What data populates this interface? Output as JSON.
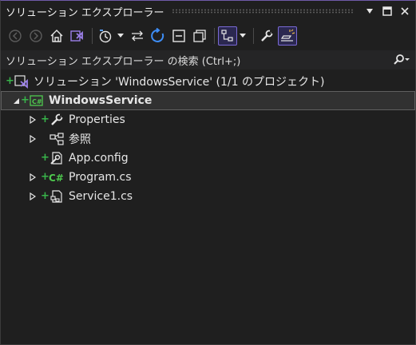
{
  "window": {
    "title": "ソリューション エクスプローラー"
  },
  "search": {
    "placeholder": "ソリューション エクスプローラー の検索 (Ctrl+;)"
  },
  "toolbar": {
    "buttons": [
      "back",
      "forward",
      "home",
      "switch-views",
      "pending-changes-filter",
      "sync-with-active-document",
      "refresh",
      "collapse-all",
      "show-all-files",
      "preview-selected-items",
      "properties",
      "view-code"
    ]
  },
  "tree": {
    "solution": "ソリューション 'WindowsService' (1/1 のプロジェクト)",
    "project": "WindowsService",
    "items": [
      {
        "label": "Properties",
        "icon": "wrench-icon"
      },
      {
        "label": "参照",
        "icon": "references-icon"
      },
      {
        "label": "App.config",
        "icon": "config-file-icon"
      },
      {
        "label": "Program.cs",
        "icon": "csharp-file-icon"
      },
      {
        "label": "Service1.cs",
        "icon": "component-file-icon"
      }
    ]
  },
  "colors": {
    "accent": "#7a6ad6",
    "background": "#1f1f1f",
    "added_marker": "#38b44a",
    "vs_purple": "#9b7fe8",
    "csharp_green": "#4ec94e"
  }
}
